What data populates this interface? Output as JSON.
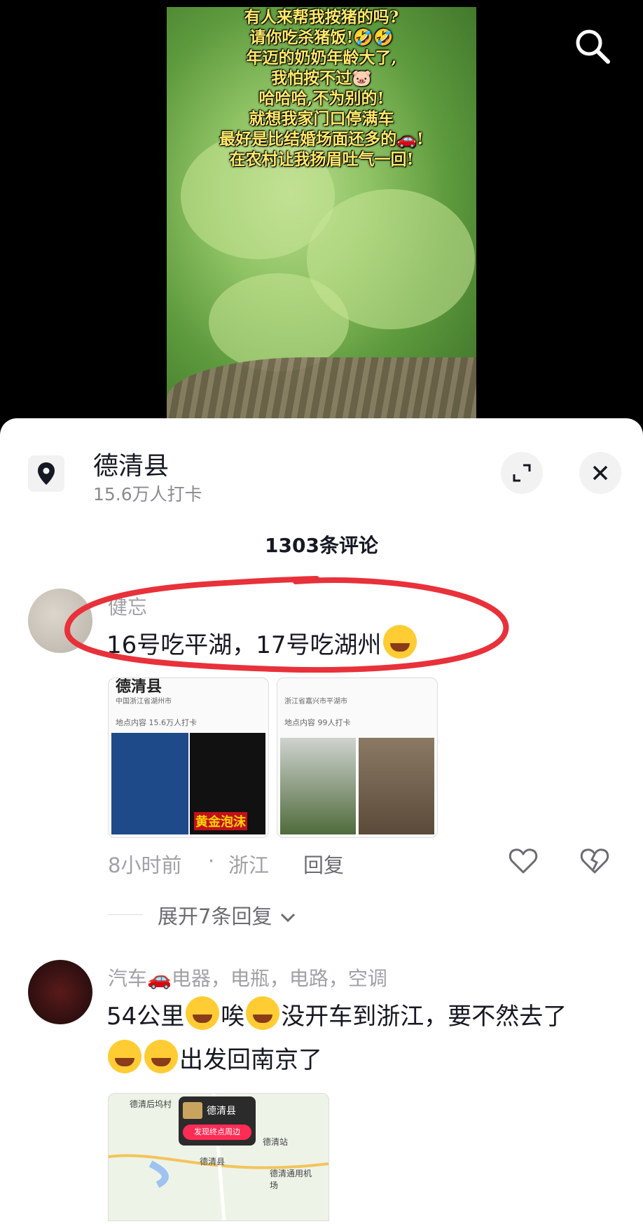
{
  "video": {
    "caption_lines": [
      "有人来帮我按猪的吗?",
      "请你吃杀猪饭!🤣🤣",
      "年迈的奶奶年龄大了,",
      "我怕按不过🐷",
      "哈哈哈,不为别的!",
      "就想我家门口停满车",
      "最好是比结婚场面还多的🚗!",
      "在农村让我扬眉吐气一回!"
    ],
    "search_icon": "search-icon"
  },
  "location": {
    "icon": "location-pin-icon",
    "title": "德清县",
    "subtitle": "15.6万人打卡"
  },
  "header": {
    "expand_icon": "expand-icon",
    "close_icon": "close-icon",
    "comment_count": "1303条评论"
  },
  "comments": [
    {
      "username": "健忘",
      "text": "16号吃平湖，17号吃湖州",
      "emoji": "crying-laughing-emoji",
      "images": [
        {
          "title": "德清县",
          "sub1": "中国浙江省湖州市",
          "sub2": "地点内容 15.6万人打卡",
          "tag": "黄金泡沫"
        },
        {
          "title": "",
          "sub1": "浙江省嘉兴市平湖市",
          "sub2": "地点内容 99人打卡",
          "tag": ""
        }
      ],
      "time": "8小时前",
      "region": "浙江",
      "reply_label": "回复",
      "like_icon": "heart-icon",
      "dislike_icon": "broken-heart-icon",
      "expand_label": "展开7条回复"
    },
    {
      "username": "汽车🚗电器，电瓶，电路，空调",
      "text_line1a": "54公里",
      "text_line1b": "唉",
      "text_line1c": "没开车到浙江，要不然去了",
      "text_line2": "出发回南京了",
      "map": {
        "popup_title": "德清县",
        "popup_button": "发现终点周边",
        "labels": [
          "德清后坞村",
          "德清站",
          "德清县",
          "德清通用机场"
        ]
      }
    }
  ],
  "colors": {
    "accent": "#fe2c55",
    "caption_yellow": "#ffe96a",
    "annotation_red": "#e8313a"
  }
}
